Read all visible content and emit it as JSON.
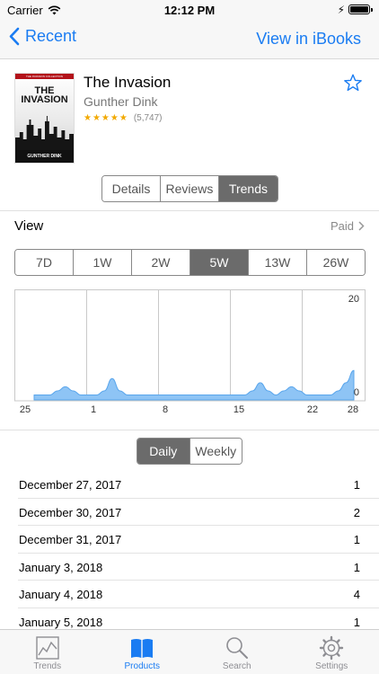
{
  "status": {
    "carrier": "Carrier",
    "time": "12:12 PM"
  },
  "navbar": {
    "back_label": "Recent",
    "right_label": "View in iBooks"
  },
  "book": {
    "title": "The Invasion",
    "author": "Gunther Dink",
    "rating_stars": "★★★★★",
    "rating_count": "(5,747)",
    "cover": {
      "series": "THE INVASION COLLECTION",
      "title": "THE INVASION",
      "author": "GUNTHER DINK"
    }
  },
  "detail_tabs": [
    {
      "label": "Details",
      "active": false
    },
    {
      "label": "Reviews",
      "active": false
    },
    {
      "label": "Trends",
      "active": true
    }
  ],
  "view": {
    "label": "View",
    "filter": "Paid"
  },
  "ranges": [
    {
      "label": "7D",
      "active": false
    },
    {
      "label": "1W",
      "active": false
    },
    {
      "label": "2W",
      "active": false
    },
    {
      "label": "5W",
      "active": true
    },
    {
      "label": "13W",
      "active": false
    },
    {
      "label": "26W",
      "active": false
    }
  ],
  "chart_data": {
    "type": "area",
    "x_ticks": [
      "25",
      "1",
      "8",
      "15",
      "22",
      "28"
    ],
    "y_ticks": [
      "20",
      "0"
    ],
    "ylim": [
      0,
      20
    ],
    "color": "#8ec4f5",
    "series": [
      {
        "values": [
          0,
          0,
          0,
          1,
          2,
          1,
          0,
          0,
          0,
          1,
          4,
          1,
          0,
          0,
          0,
          0,
          0,
          0,
          0,
          0,
          0,
          0,
          0,
          0,
          0,
          0,
          0,
          0,
          1,
          3,
          1,
          0,
          1,
          2,
          1,
          0,
          0,
          0,
          0,
          1,
          3,
          6
        ]
      }
    ]
  },
  "period_tabs": [
    {
      "label": "Daily",
      "active": true
    },
    {
      "label": "Weekly",
      "active": false
    }
  ],
  "sales": [
    {
      "date": "December 27, 2017",
      "count": "1"
    },
    {
      "date": "December 30, 2017",
      "count": "2"
    },
    {
      "date": "December 31, 2017",
      "count": "1"
    },
    {
      "date": "January 3, 2018",
      "count": "1"
    },
    {
      "date": "January 4, 2018",
      "count": "4"
    },
    {
      "date": "January 5, 2018",
      "count": "1"
    }
  ],
  "tabbar": [
    {
      "label": "Trends",
      "icon": "chart-icon",
      "active": false
    },
    {
      "label": "Products",
      "icon": "book-icon",
      "active": true
    },
    {
      "label": "Search",
      "icon": "search-icon",
      "active": false
    },
    {
      "label": "Settings",
      "icon": "gear-icon",
      "active": false
    }
  ],
  "colors": {
    "accent": "#1a7cf2",
    "segment_active": "#6b6b6b",
    "chart_fill": "#8ec4f5",
    "star": "#f2a900"
  }
}
